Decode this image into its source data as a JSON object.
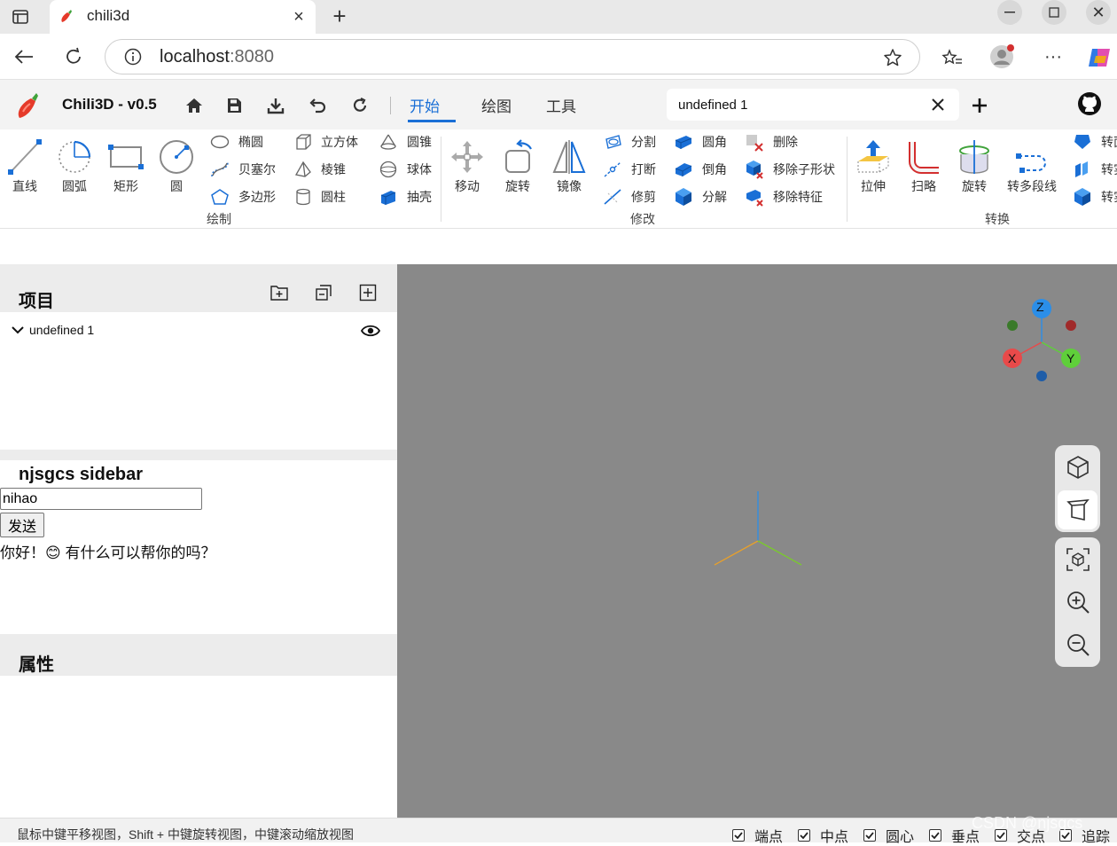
{
  "browser": {
    "tab_title": "chili3d",
    "url_host": "localhost",
    "url_port": ":8080"
  },
  "app": {
    "title": "Chili3D - v0.5",
    "tabs": [
      "开始",
      "绘图",
      "工具"
    ],
    "active_tab": "开始",
    "document_tab": "undefined 1"
  },
  "ribbon": {
    "draw": {
      "big": [
        "直线",
        "圆弧",
        "矩形",
        "圆"
      ],
      "col1": [
        "椭圆",
        "贝塞尔",
        "多边形"
      ],
      "col2": [
        "立方体",
        "棱锥",
        "圆柱"
      ],
      "col3": [
        "圆锥",
        "球体",
        "抽壳"
      ],
      "label": "绘制"
    },
    "modify": {
      "big": [
        "移动",
        "旋转",
        "镜像"
      ],
      "col1": [
        "分割",
        "打断",
        "修剪"
      ],
      "col2": [
        "圆角",
        "倒角",
        "分解"
      ],
      "col3": [
        "删除",
        "移除子形状",
        "移除特征"
      ],
      "label": "修改"
    },
    "convert": {
      "big": [
        "拉伸",
        "扫略",
        "旋转",
        "转多段线"
      ],
      "col1": [
        "转面",
        "转实体",
        "转实体"
      ],
      "label": "转换"
    }
  },
  "project_panel": {
    "title": "项目",
    "items": [
      {
        "name": "undefined 1"
      }
    ]
  },
  "sidebar_panel": {
    "title": "njsgcs sidebar",
    "input_value": "nihao",
    "send_label": "发送",
    "reply": "你好！😊 有什么可以帮你的吗？"
  },
  "properties_panel": {
    "title": "属性"
  },
  "viewcube": {
    "axes": [
      "Z",
      "X",
      "Y"
    ]
  },
  "status": {
    "hint": "鼠标中键平移视图，Shift + 中键旋转视图，中键滚动缩放视图",
    "snaps": [
      "端点",
      "中点",
      "圆心",
      "垂点",
      "交点",
      "追踪"
    ],
    "watermark": "CSDN @njsgcs"
  },
  "colors": {
    "accent": "#1a6fd6",
    "viewport_bg": "#898989",
    "axis_x": "#e84a4a",
    "axis_y": "#5fcf3a",
    "axis_z": "#2b8ee8"
  }
}
